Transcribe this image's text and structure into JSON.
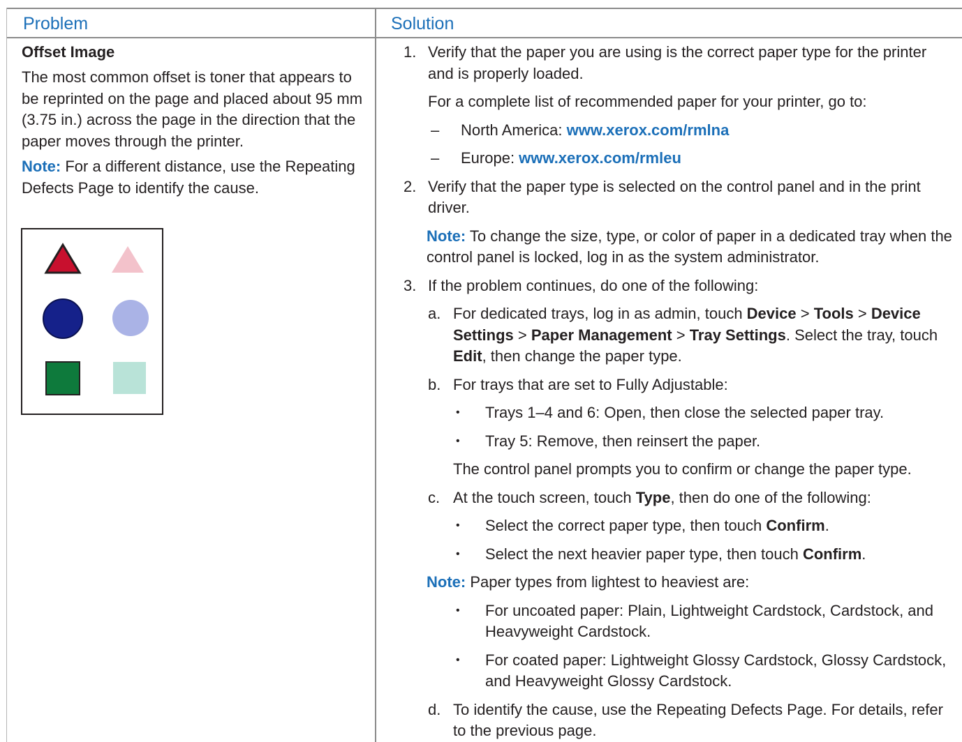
{
  "header": {
    "problem": "Problem",
    "solution": "Solution"
  },
  "problem": {
    "title": "Offset Image",
    "description": "The most common offset is toner that appears to be reprinted on the page and placed about 95 mm (3.75 in.) across the page in the direction that the paper moves through the printer.",
    "note_label": "Note:",
    "note_text": " For a different distance, use the Repeating Defects Page to identify the cause.",
    "sample_colors": {
      "triangle": "#c8102e",
      "triangle_offset": "#f3c2cb",
      "circle": "#15218a",
      "circle_offset": "#aab3e6",
      "square": "#0e7a3c",
      "square_offset": "#b9e3d8"
    }
  },
  "solution": {
    "s1": {
      "num": "1.",
      "text": "Verify that the paper you are using is the correct paper type for the printer and is properly loaded.",
      "list_intro": "For a complete list of recommended paper for your printer, go to:",
      "dash": "–",
      "na_label": "North America: ",
      "na_link": "www.xerox.com/rmlna",
      "eu_label": "Europe: ",
      "eu_link": "www.xerox.com/rmleu"
    },
    "s2": {
      "num": "2.",
      "text": "Verify that the paper type is selected on the control panel and in the print driver.",
      "note_label": "Note:",
      "note_text": " To change the size, type, or color of paper in a dedicated tray when the control panel is locked, log in as the system administrator."
    },
    "s3": {
      "num": "3.",
      "text": "If the problem continues, do one of the following:",
      "a": {
        "mk": "a.",
        "t1": "For dedicated trays, log in as admin, touch ",
        "b1": "Device",
        "sep1": " > ",
        "b2": "Tools",
        "sep2": " > ",
        "b3": "Device Settings",
        "sep3": " > ",
        "b4": "Paper Management",
        "sep4": " > ",
        "b5": "Tray Settings",
        "t2": ". Select the tray, touch ",
        "b6": "Edit",
        "t3": ", then change the paper type."
      },
      "b": {
        "mk": "b.",
        "text": "For trays that are set to Fully Adjustable:",
        "bullet": "•",
        "item1": "Trays 1–4 and 6: Open, then close the selected paper tray.",
        "item2": "Tray 5: Remove, then reinsert the paper.",
        "after": "The control panel prompts you to confirm or change the paper type."
      },
      "c": {
        "mk": "c.",
        "t1": "At the touch screen, touch ",
        "b1": "Type",
        "t2": ", then do one of the following:",
        "item1_t": "Select the correct paper type, then touch ",
        "item1_b": "Confirm",
        "item1_end": ".",
        "item2_t": "Select the next heavier paper type, then touch ",
        "item2_b": "Confirm",
        "item2_end": "."
      },
      "note_label": "Note:",
      "note_text": " Paper types from lightest to heaviest are:",
      "weights": {
        "item1": "For uncoated paper: Plain, Lightweight Cardstock, Cardstock, and Heavyweight Cardstock.",
        "item2": "For coated paper: Lightweight Glossy Cardstock, Glossy Cardstock, and Heavyweight Glossy Cardstock."
      },
      "d": {
        "mk": "d.",
        "text": "To identify the cause, use the Repeating Defects Page. For details, refer to the previous page."
      }
    }
  }
}
